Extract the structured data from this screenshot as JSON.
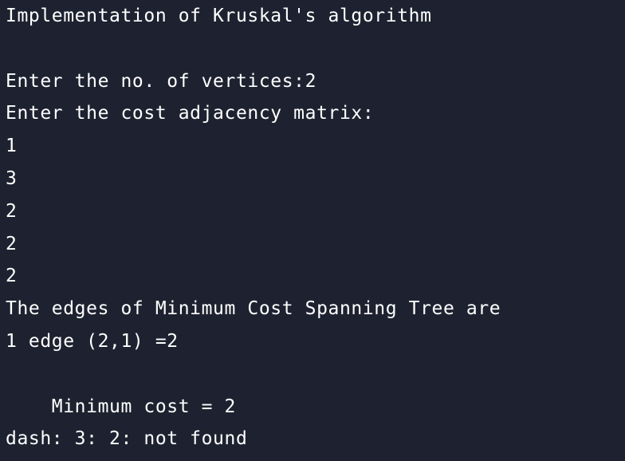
{
  "terminal": {
    "background": "#1e2230",
    "foreground": "#ffffff",
    "lines": [
      "Implementation of Kruskal's algorithm",
      "",
      "Enter the no. of vertices:2",
      "Enter the cost adjacency matrix:",
      "1",
      "3",
      "2",
      "2",
      "2",
      "The edges of Minimum Cost Spanning Tree are",
      "1 edge (2,1) =2",
      "",
      "    Minimum cost = 2",
      "dash: 3: 2: not found"
    ]
  }
}
